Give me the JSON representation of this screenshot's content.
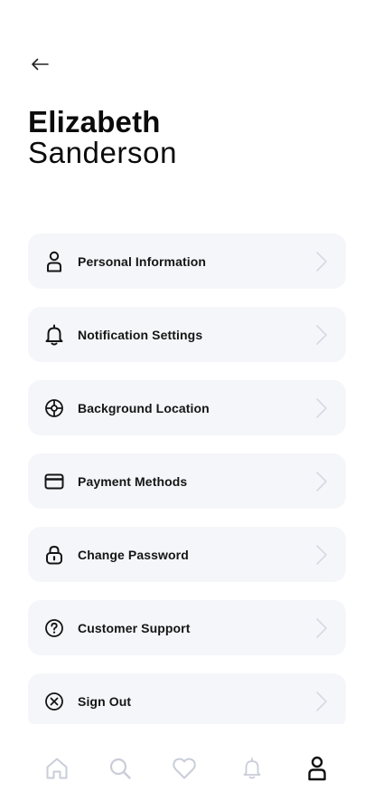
{
  "profile": {
    "first_name": "Elizabeth",
    "last_name": "Sanderson"
  },
  "menu": {
    "items": [
      {
        "label": "Personal Information",
        "icon": "user-icon"
      },
      {
        "label": "Notification Settings",
        "icon": "bell-icon"
      },
      {
        "label": "Background Location",
        "icon": "location-target-icon"
      },
      {
        "label": "Payment Methods",
        "icon": "credit-card-icon"
      },
      {
        "label": "Change Password",
        "icon": "lock-icon"
      },
      {
        "label": "Customer Support",
        "icon": "help-circle-icon"
      },
      {
        "label": "Sign Out",
        "icon": "close-circle-icon"
      }
    ]
  },
  "tabbar": {
    "tabs": [
      {
        "icon": "home-icon",
        "active": false
      },
      {
        "icon": "search-icon",
        "active": false
      },
      {
        "icon": "heart-icon",
        "active": false
      },
      {
        "icon": "bell-icon",
        "active": false
      },
      {
        "icon": "user-icon",
        "active": true
      }
    ]
  },
  "colors": {
    "card_background": "#f5f6fa",
    "text_primary": "#111111",
    "tab_inactive": "#c9cdd8",
    "tab_active": "#111111",
    "chevron": "#d7dae3"
  }
}
